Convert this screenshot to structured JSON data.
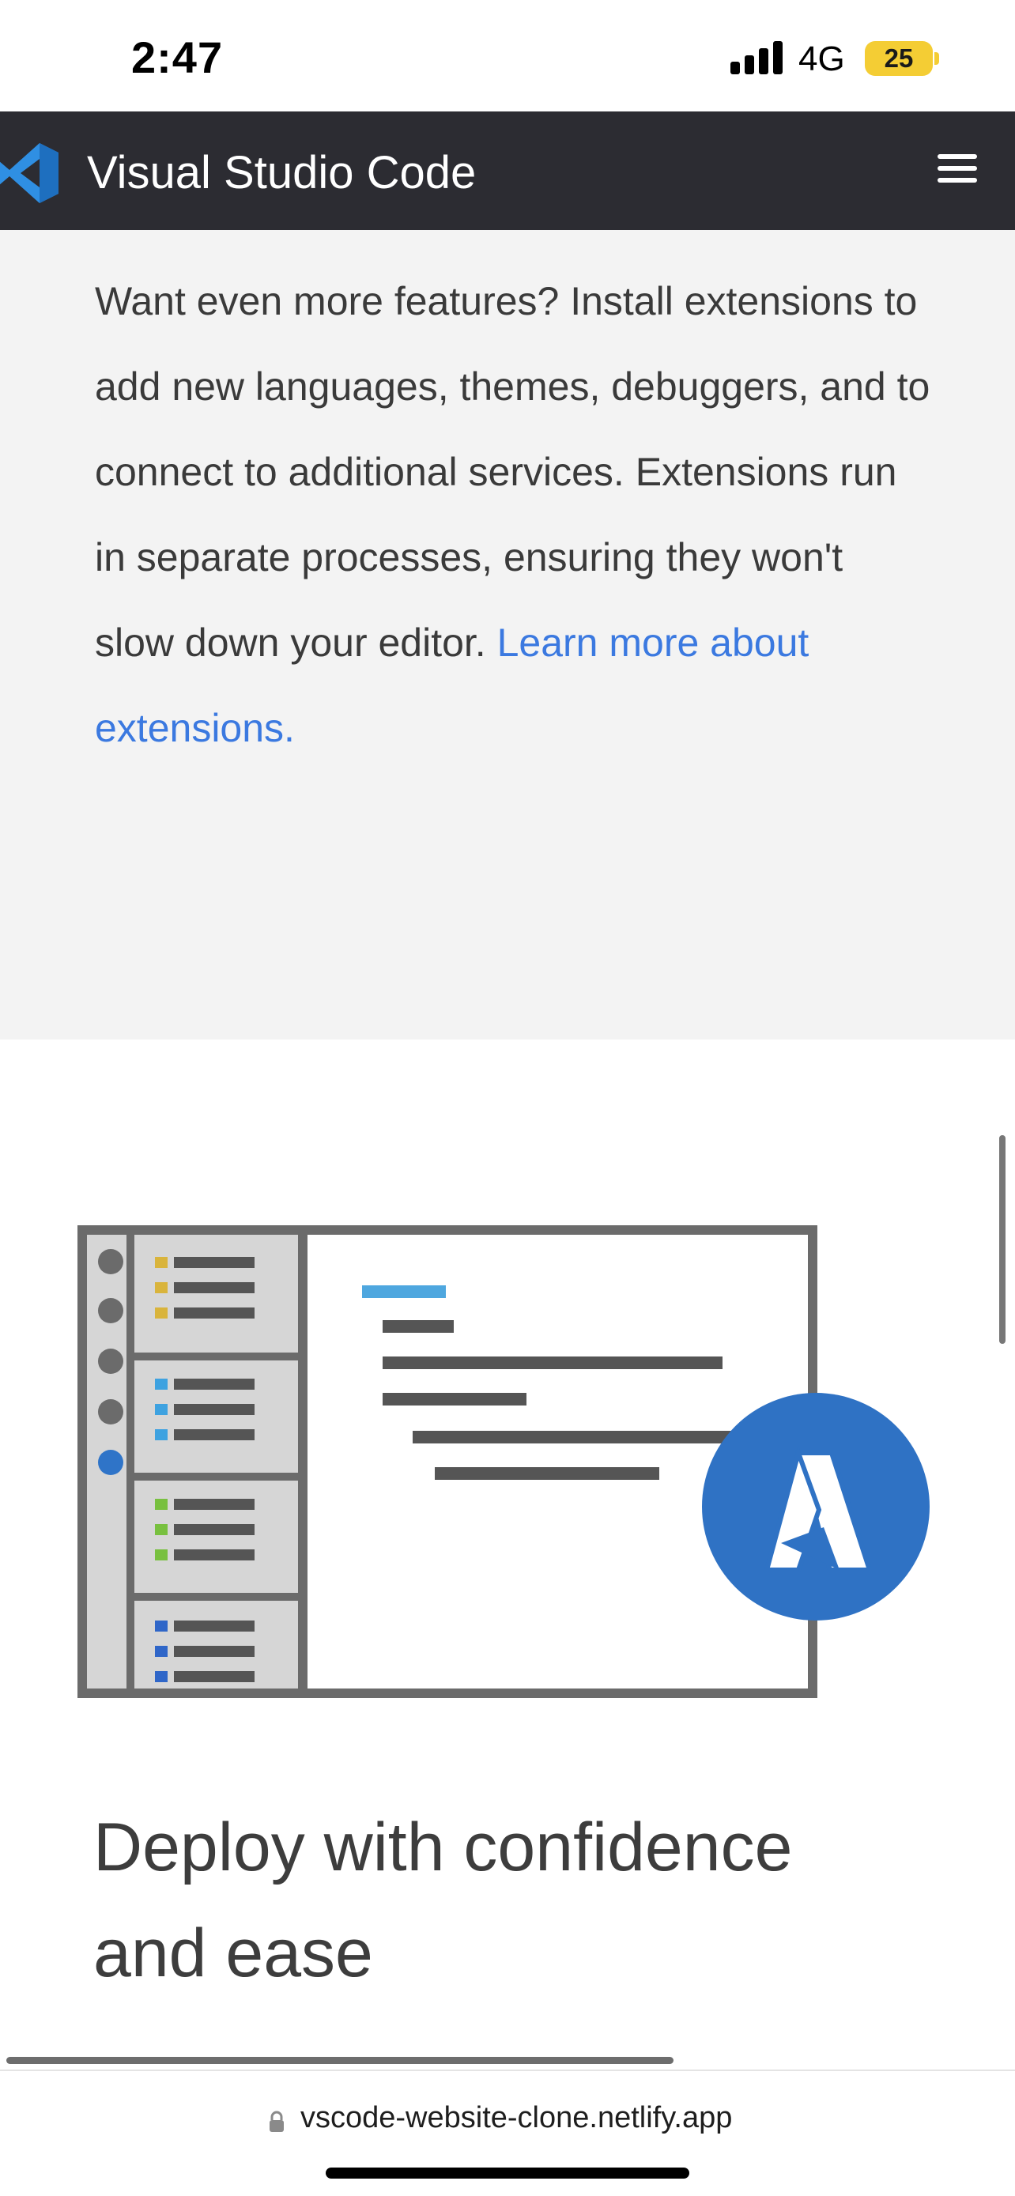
{
  "status_bar": {
    "time": "2:47",
    "network": "4G",
    "battery": "25",
    "battery_color": "#f4cd34"
  },
  "navbar": {
    "title": "Visual Studio Code",
    "logo_icon": "vscode-logo-icon",
    "menu_icon": "hamburger-menu-icon",
    "background": "#2c2c32"
  },
  "extensions": {
    "paragraph": "Want even more features? Install extensions to add new languages, themes, debuggers, and to connect to additional services. Extensions run in separate processes, ensuring they won't slow down your editor. ",
    "link": "Learn more about extensions.",
    "link_color": "#3b79e0"
  },
  "deploy": {
    "heading": "Deploy with confidence and ease"
  },
  "browser": {
    "url": "vscode-website-clone.netlify.app"
  }
}
